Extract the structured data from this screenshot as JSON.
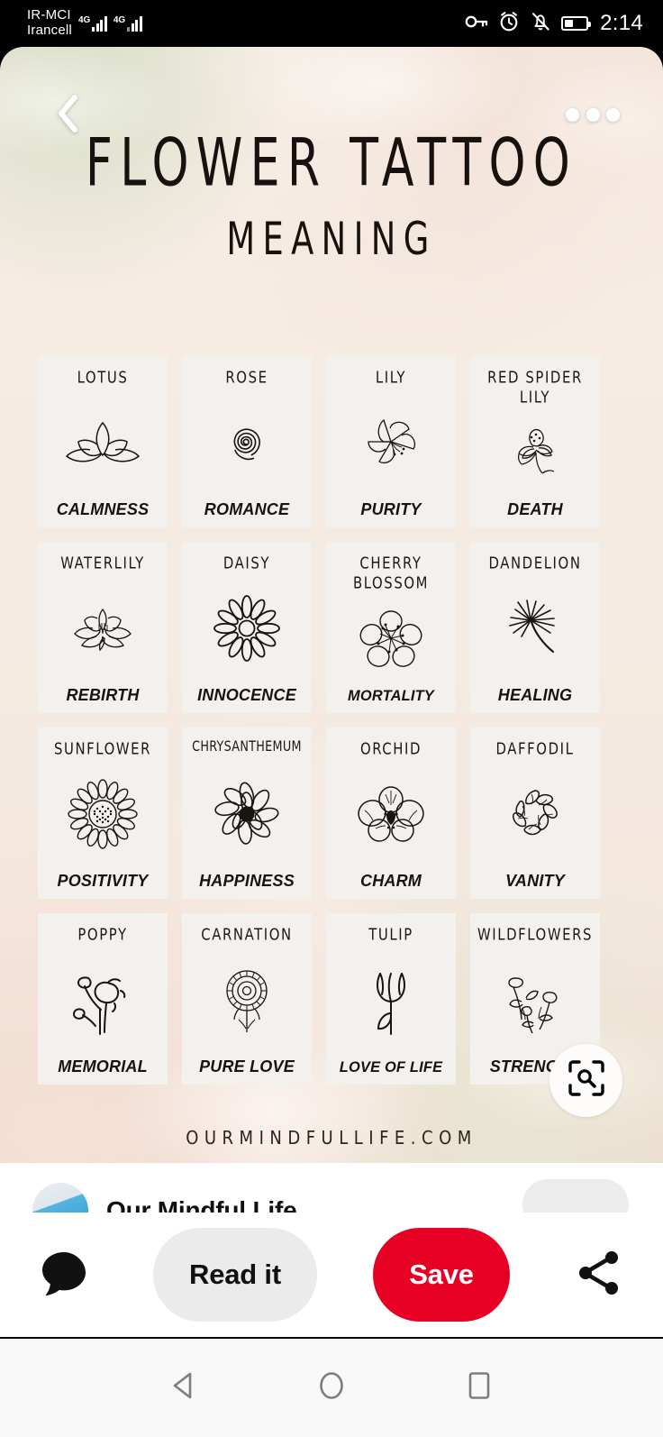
{
  "statusbar": {
    "carrier_line1": "IR-MCI",
    "carrier_line2": "Irancell",
    "sim1_network": "4G",
    "sim2_network": "4G",
    "icons": [
      "key-icon",
      "alarm-icon",
      "bell-muted-icon",
      "battery-icon"
    ],
    "time": "2:14"
  },
  "header": {
    "back_icon": "chevron-left-icon",
    "more_icon": "more-options-icon"
  },
  "pin": {
    "title_main": "FLOWER TATTOO",
    "title_sub": "MEANING",
    "watermark": "OURMINDFULLIFE.COM",
    "lens_icon": "lens-search-icon",
    "cards": [
      {
        "name": "LOTUS",
        "meaning": "CALMNESS",
        "art": "lotus-flower-icon"
      },
      {
        "name": "ROSE",
        "meaning": "ROMANCE",
        "art": "rose-flower-icon"
      },
      {
        "name": "LILY",
        "meaning": "PURITY",
        "art": "lily-flower-icon"
      },
      {
        "name": "RED SPIDER\nLILY",
        "meaning": "DEATH",
        "art": "red-spider-lily-icon"
      },
      {
        "name": "WATERLILY",
        "meaning": "REBIRTH",
        "art": "waterlily-flower-icon"
      },
      {
        "name": "DAISY",
        "meaning": "INNOCENCE",
        "art": "daisy-flower-icon"
      },
      {
        "name": "CHERRY\nBLOSSOM",
        "meaning": "MORTALITY",
        "art": "cherry-blossom-icon"
      },
      {
        "name": "DANDELION",
        "meaning": "HEALING",
        "art": "dandelion-seed-icon"
      },
      {
        "name": "SUNFLOWER",
        "meaning": "POSITIVITY",
        "art": "sunflower-icon"
      },
      {
        "name": "CHRYSANTHEMUM",
        "meaning": "HAPPINESS",
        "art": "chrysanthemum-icon"
      },
      {
        "name": "ORCHID",
        "meaning": "CHARM",
        "art": "orchid-flower-icon"
      },
      {
        "name": "DAFFODIL",
        "meaning": "VANITY",
        "art": "daffodil-flower-icon"
      },
      {
        "name": "POPPY",
        "meaning": "MEMORIAL",
        "art": "poppy-flower-icon"
      },
      {
        "name": "CARNATION",
        "meaning": "PURE LOVE",
        "art": "carnation-flower-icon"
      },
      {
        "name": "TULIP",
        "meaning": "LOVE OF LIFE",
        "art": "tulip-flower-icon"
      },
      {
        "name": "WILDFLOWERS",
        "meaning": "STRENGTH",
        "art": "wildflowers-icon"
      }
    ]
  },
  "attribution": {
    "name": "Our Mindful Life",
    "avatar": "profile-avatar"
  },
  "actionbar": {
    "comment_icon": "comment-bubble-icon",
    "read_it_label": "Read it",
    "save_label": "Save",
    "share_icon": "share-icon",
    "save_color": "#e60023"
  },
  "navbar": {
    "back_icon": "android-back-icon",
    "home_icon": "android-home-icon",
    "recents_icon": "android-recents-icon"
  }
}
